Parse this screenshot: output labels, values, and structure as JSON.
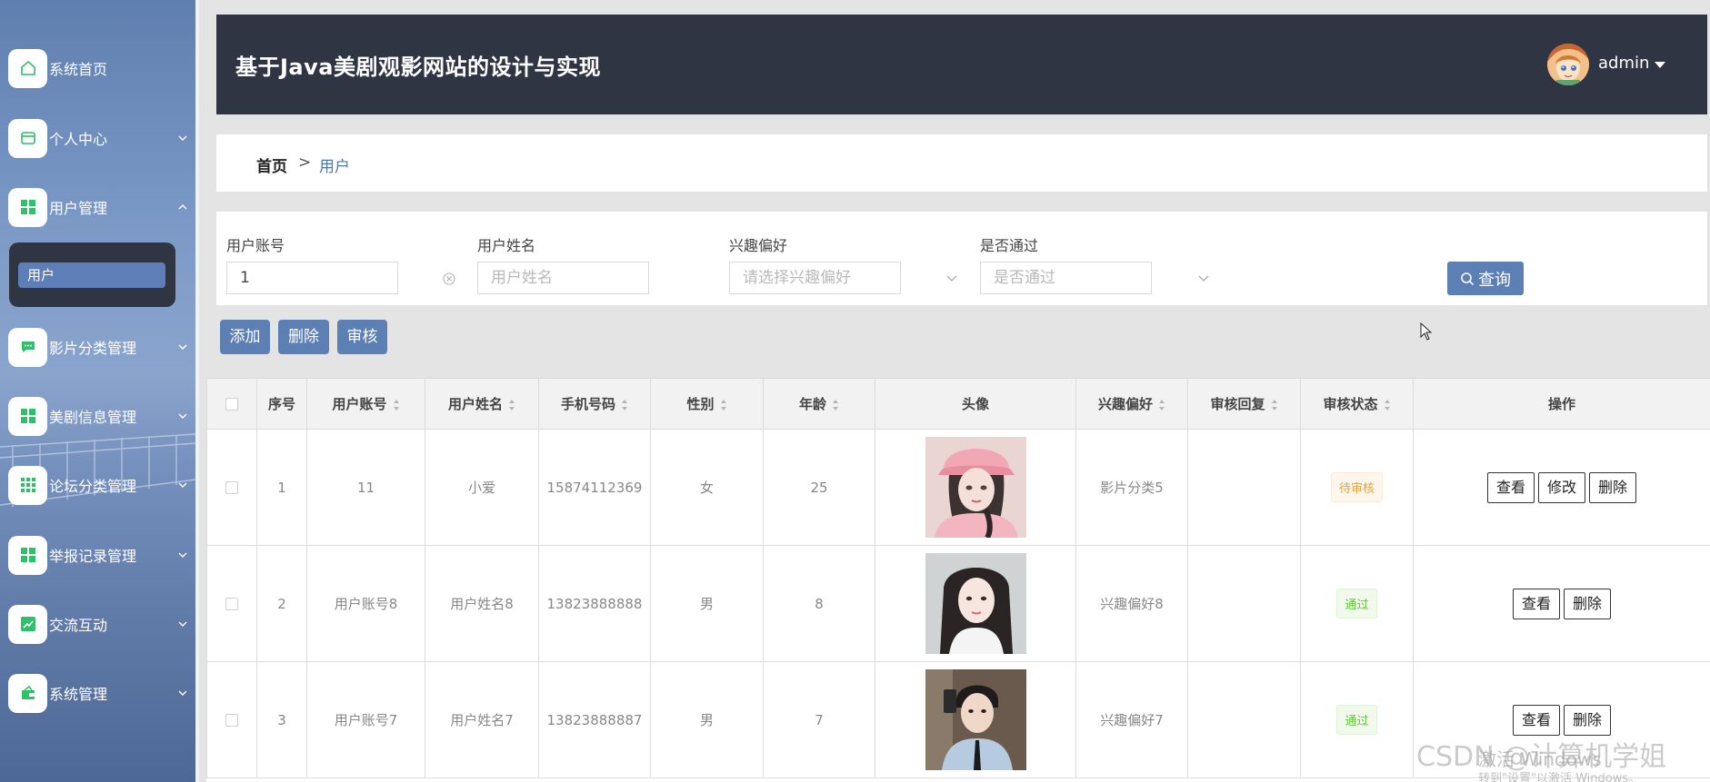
{
  "sidebar": {
    "items": [
      {
        "label": "系统首页",
        "icon": "home-icon"
      },
      {
        "label": "个人中心",
        "icon": "wallet-icon"
      },
      {
        "label": "用户管理",
        "icon": "grid-icon"
      },
      {
        "label": "影片分类管理",
        "icon": "chat-icon"
      },
      {
        "label": "美剧信息管理",
        "icon": "grid-icon"
      },
      {
        "label": "论坛分类管理",
        "icon": "grid9-icon"
      },
      {
        "label": "举报记录管理",
        "icon": "grid-icon"
      },
      {
        "label": "交流互动",
        "icon": "chart-icon"
      },
      {
        "label": "系统管理",
        "icon": "bag-icon"
      }
    ],
    "submenu_active": "用户"
  },
  "header": {
    "title": "基于Java美剧观影网站的设计与实现",
    "user": "admin"
  },
  "breadcrumb": {
    "home": "首页",
    "separator": ">",
    "current": "用户"
  },
  "search": {
    "account_label": "用户账号",
    "account_value": "1",
    "name_label": "用户姓名",
    "name_placeholder": "用户姓名",
    "interest_label": "兴趣偏好",
    "interest_placeholder": "请选择兴趣偏好",
    "pass_label": "是否通过",
    "pass_placeholder": "是否通过",
    "query_label": "查询"
  },
  "actions": {
    "add": "添加",
    "delete": "删除",
    "review": "审核"
  },
  "table": {
    "headers": {
      "index": "序号",
      "account": "用户账号",
      "name": "用户姓名",
      "phone": "手机号码",
      "gender": "性别",
      "age": "年龄",
      "avatar": "头像",
      "interest": "兴趣偏好",
      "reply": "审核回复",
      "status": "审核状态",
      "ops": "操作"
    },
    "rows": [
      {
        "index": "1",
        "account": "11",
        "name": "小爱",
        "phone": "15874112369",
        "gender": "女",
        "age": "25",
        "interest": "影片分类5",
        "reply": "",
        "status": "待审核",
        "view": "查看",
        "edit": "修改",
        "del": "删除"
      },
      {
        "index": "2",
        "account": "用户账号8",
        "name": "用户姓名8",
        "phone": "13823888888",
        "gender": "男",
        "age": "8",
        "interest": "兴趣偏好8",
        "reply": "",
        "status": "通过",
        "view": "查看",
        "del": "删除"
      },
      {
        "index": "3",
        "account": "用户账号7",
        "name": "用户姓名7",
        "phone": "13823888887",
        "gender": "男",
        "age": "7",
        "interest": "兴趣偏好7",
        "reply": "",
        "status": "通过",
        "view": "查看",
        "del": "删除"
      }
    ]
  },
  "watermark": {
    "csdn": "CSDN @计算机学姐",
    "activate": "激活 Windows",
    "activate_sub": "转到\"设置\"以激活 Windows。"
  },
  "colors": {
    "header_bg": "#303543",
    "accent": "#5c7fb4",
    "status_wait": "#e6a23c",
    "status_pass": "#67c23a"
  }
}
